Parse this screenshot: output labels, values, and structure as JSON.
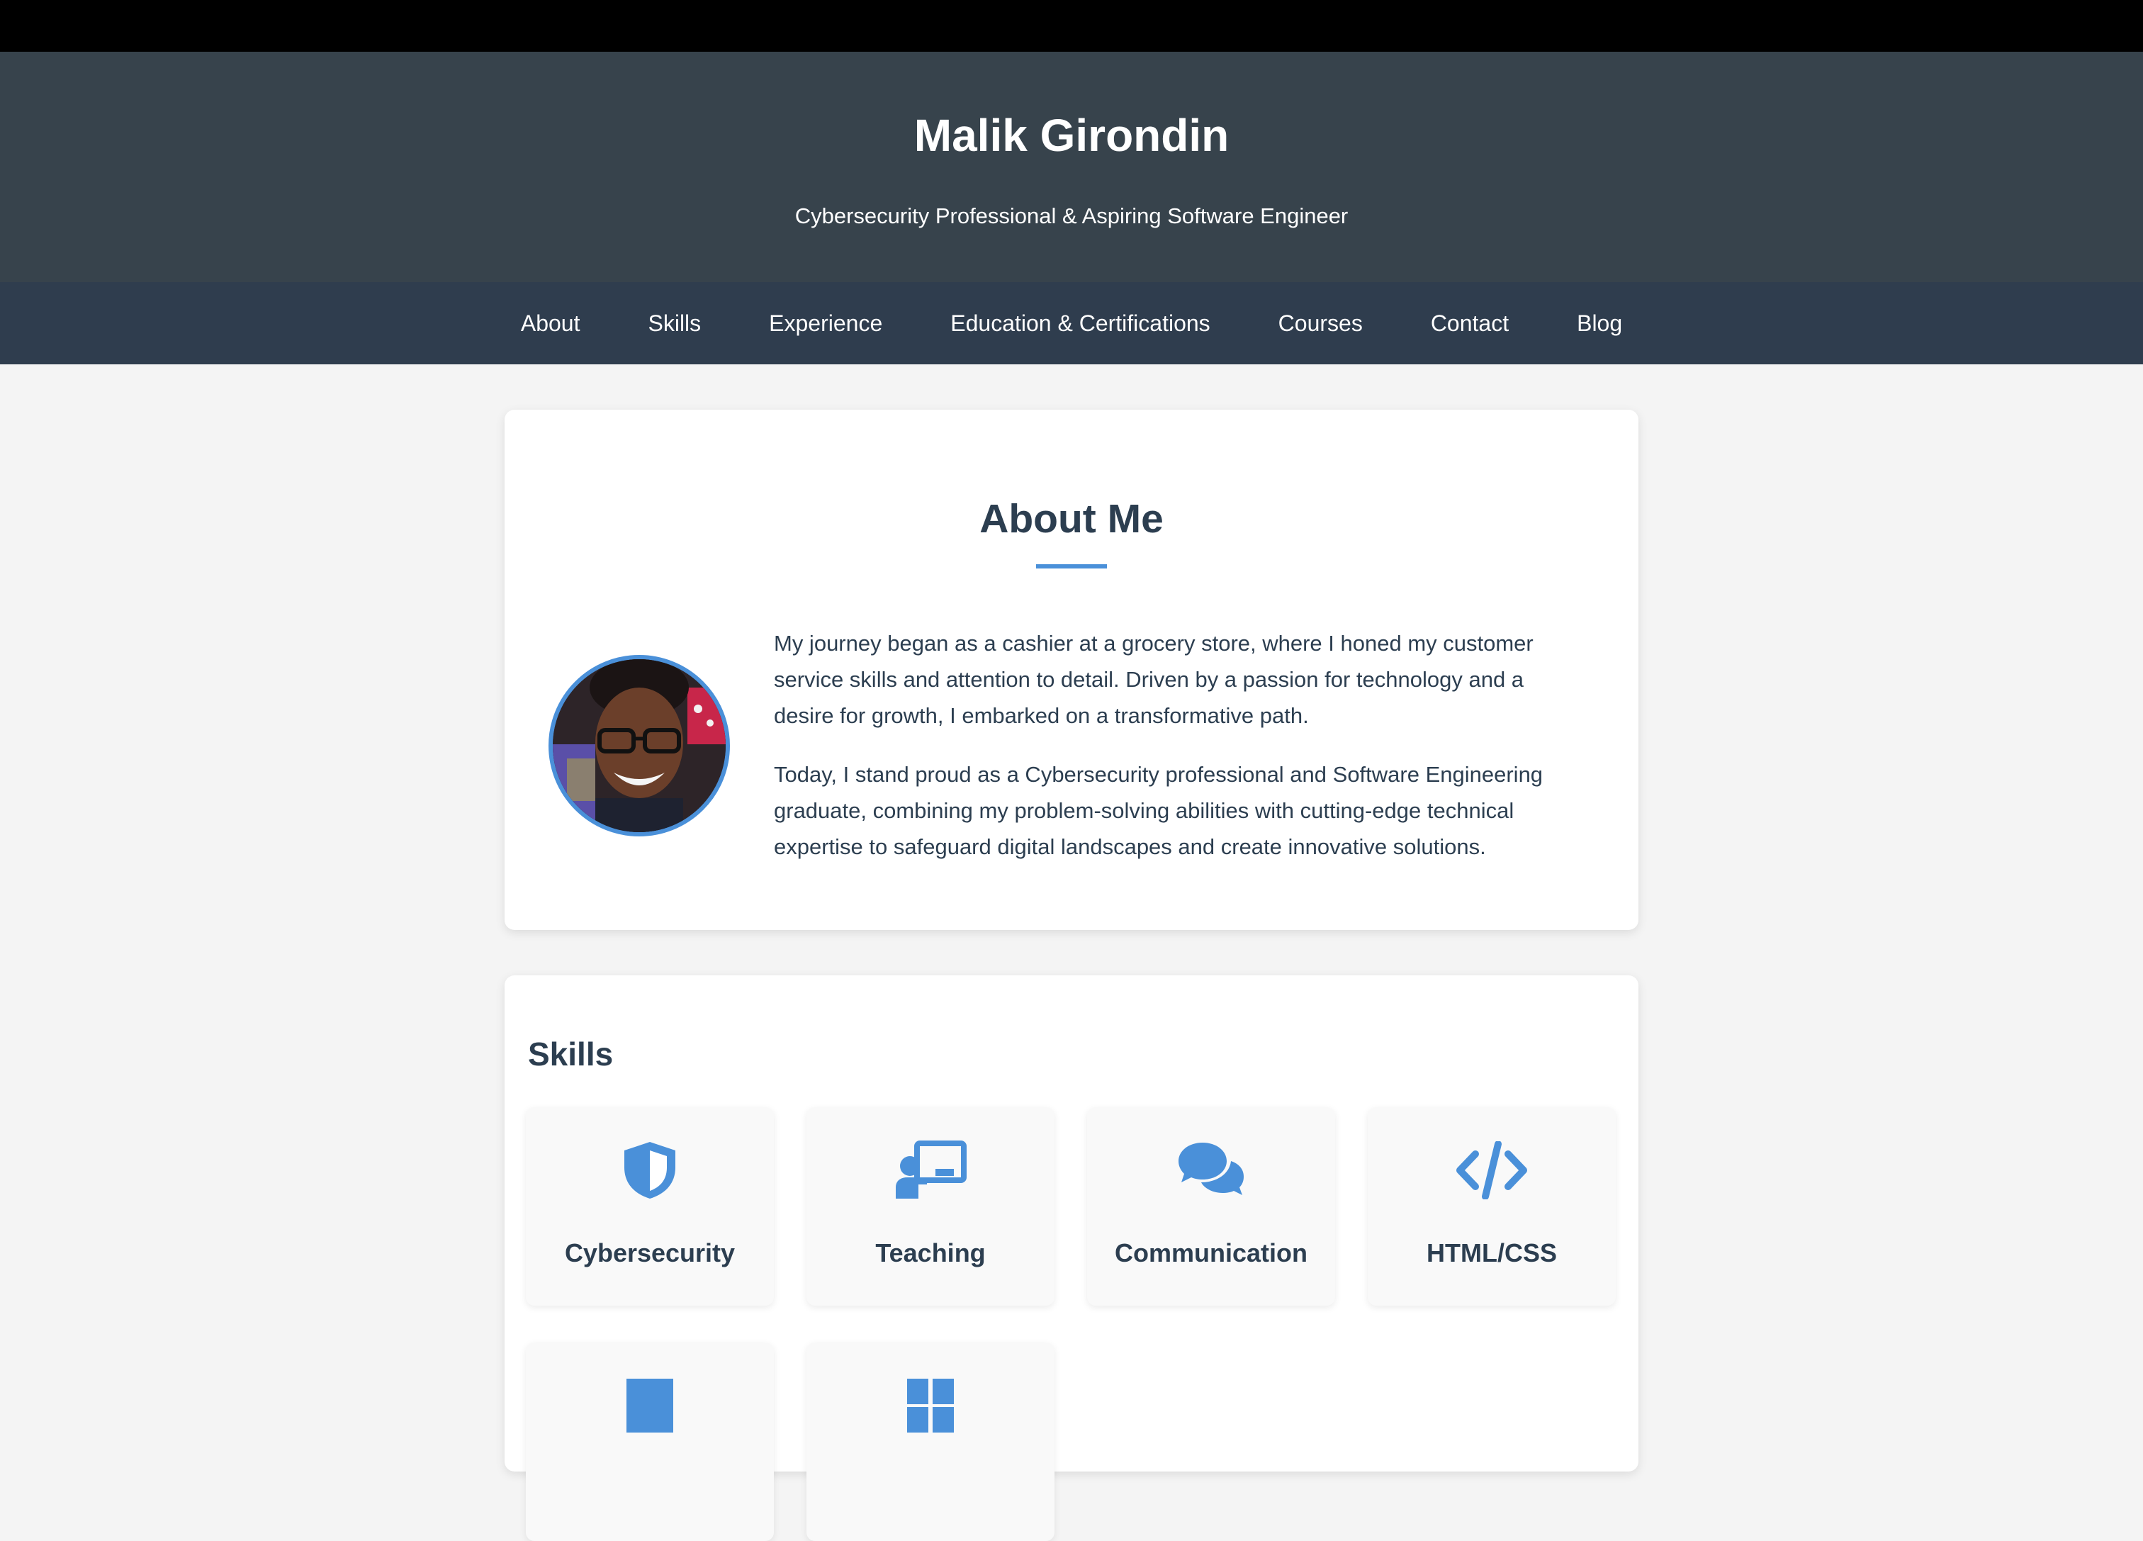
{
  "header": {
    "name": "Malik Girondin",
    "tagline": "Cybersecurity Professional & Aspiring Software Engineer"
  },
  "nav": {
    "items": [
      {
        "label": "About"
      },
      {
        "label": "Skills"
      },
      {
        "label": "Experience"
      },
      {
        "label": "Education & Certifications"
      },
      {
        "label": "Courses"
      },
      {
        "label": "Contact"
      },
      {
        "label": "Blog"
      }
    ]
  },
  "about": {
    "title": "About Me",
    "paragraphs": [
      "My journey began as a cashier at a grocery store, where I honed my customer service skills and attention to detail. Driven by a passion for technology and a desire for growth, I embarked on a transformative path.",
      "Today, I stand proud as a Cybersecurity professional and Software Engineering graduate, combining my problem-solving abilities with cutting-edge technical expertise to safeguard digital landscapes and create innovative solutions."
    ]
  },
  "skills": {
    "title": "Skills",
    "items": [
      {
        "label": "Cybersecurity",
        "icon": "shield-icon"
      },
      {
        "label": "Teaching",
        "icon": "chalkboard-teacher-icon"
      },
      {
        "label": "Communication",
        "icon": "comments-icon"
      },
      {
        "label": "HTML/CSS",
        "icon": "code-icon"
      },
      {
        "label": "",
        "icon": "unknown-icon"
      },
      {
        "label": "",
        "icon": "windows-icon"
      }
    ]
  },
  "colors": {
    "accent": "#4a90d9",
    "hero_bg": "#37434c",
    "nav_bg": "#2f3d4e",
    "text": "#2c3e50",
    "page_bg": "#f4f4f4"
  }
}
